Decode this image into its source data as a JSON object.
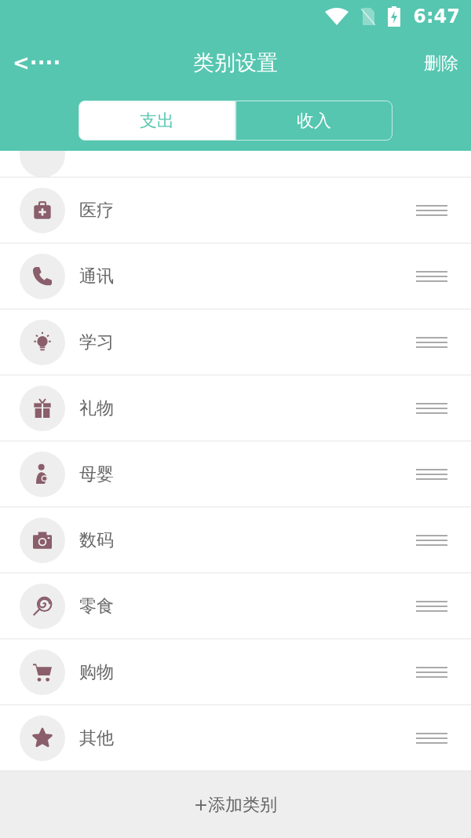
{
  "status_bar": {
    "time": "6:47"
  },
  "header": {
    "back": "<····",
    "title": "类别设置",
    "action": "删除"
  },
  "tabs": [
    {
      "label": "支出",
      "selected": true
    },
    {
      "label": "收入",
      "selected": false
    }
  ],
  "categories": [
    {
      "name": "医疗"
    },
    {
      "name": "通讯"
    },
    {
      "name": "学习"
    },
    {
      "name": "礼物"
    },
    {
      "name": "母婴"
    },
    {
      "name": "数码"
    },
    {
      "name": "零食"
    },
    {
      "name": "购物"
    },
    {
      "name": "其他"
    }
  ],
  "add_button": "+添加类别"
}
